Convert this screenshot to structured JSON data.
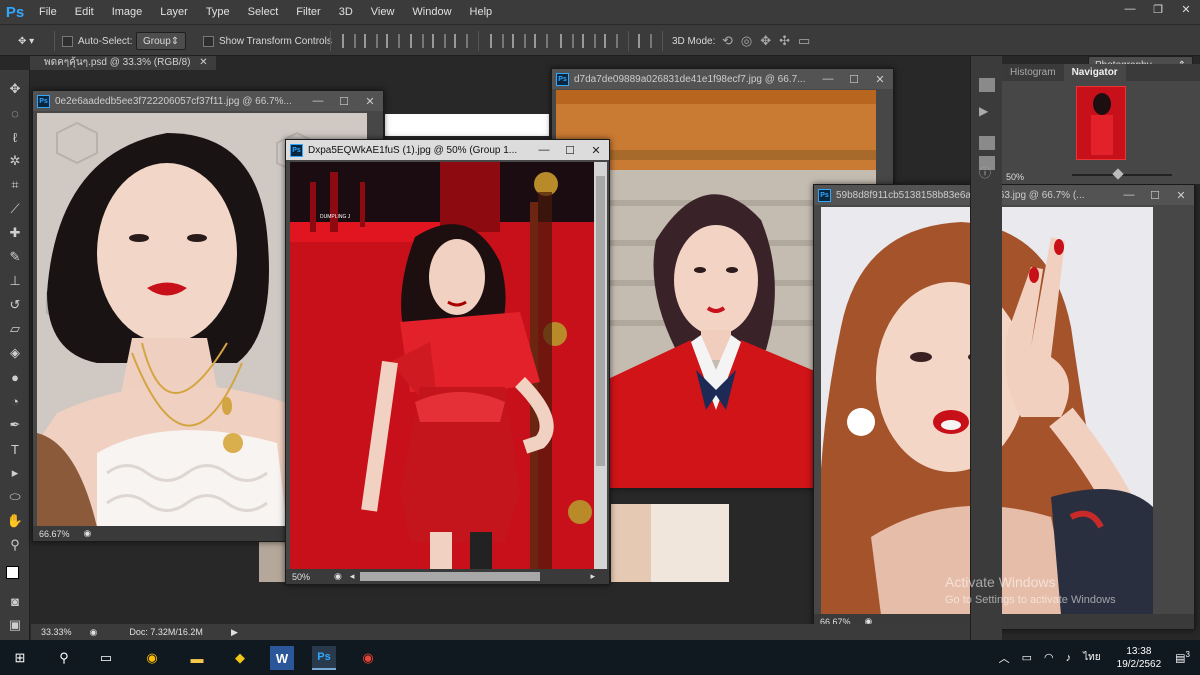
{
  "app": {
    "logo": "Ps"
  },
  "menu": [
    "File",
    "Edit",
    "Image",
    "Layer",
    "Type",
    "Select",
    "Filter",
    "3D",
    "View",
    "Window",
    "Help"
  ],
  "window_controls": {
    "minimize": "—",
    "restore": "❐",
    "close": "✕"
  },
  "options": {
    "auto_select_label": "Auto-Select:",
    "auto_select_value": "Group",
    "show_transform_label": "Show Transform Controls",
    "mode_3d_label": "3D Mode:",
    "workspace": "Photography"
  },
  "doc_tab": {
    "title": "พดคๆคุ้นๆ.psd @ 33.3% (RGB/8)",
    "close": "✕"
  },
  "windows": {
    "w1": {
      "title": "0e2e6aadedb5ee3f722206057cf37f11.jpg @ 66.7%...",
      "zoom": "66.67%"
    },
    "w2": {
      "title": "Dxpa5EQWkAE1fuS (1).jpg @ 50% (Group 1...",
      "zoom": "50%"
    },
    "w3": {
      "title": "d7da7de09889a026831de41e1f98ecf7.jpg @ 66.7...",
      "zoom": ""
    },
    "w4": {
      "title": "59b8d8f911cb5138158b83e6a258b663.jpg @ 66.7% (...",
      "zoom": "66.67%"
    }
  },
  "win_btns": {
    "min": "—",
    "max": "☐",
    "close": "✕"
  },
  "panels": {
    "histogram": "Histogram",
    "navigator": "Navigator",
    "nav_zoom": "50%"
  },
  "status": {
    "zoom": "33.33%",
    "doc": "Doc: 7.32M/16.2M"
  },
  "watermark": {
    "line1": "Activate Windows",
    "line2": "Go to Settings to activate Windows"
  },
  "image_text": {
    "w2_caption": "DUMPLING J"
  },
  "taskbar": {
    "time": "13:38",
    "date": "19/2/2562",
    "lang": "ไทย",
    "notif": "3"
  },
  "colors": {
    "accent": "#31a8ff",
    "chrome": "#3b3b3b",
    "workspace": "#282828",
    "red": "#c8101a"
  }
}
